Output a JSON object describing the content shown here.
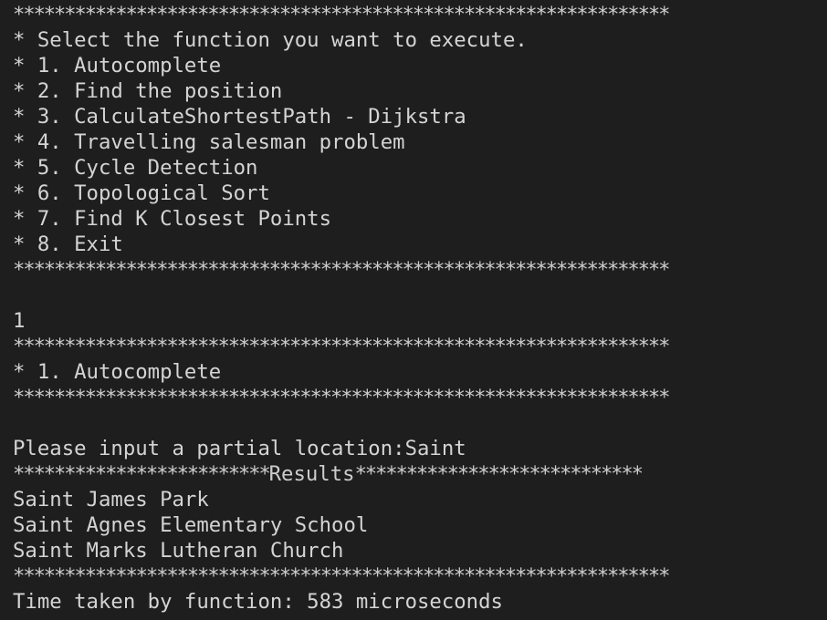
{
  "terminal": {
    "background": "#1e1e1e",
    "foreground": "#d4d4d4",
    "separator": "****************************************************************",
    "menu": {
      "prompt": "* Select the function you want to execute.",
      "items": [
        "* 1. Autocomplete",
        "* 2. Find the position",
        "* 3. CalculateShortestPath - Dijkstra",
        "* 4. Travelling salesman problem",
        "* 5. Cycle Detection",
        "* 6. Topological Sort",
        "* 7. Find K Closest Points",
        "* 8. Exit"
      ]
    },
    "user_choice": "1",
    "selected_function": "* 1. Autocomplete",
    "input_prompt": "Please input a partial location:",
    "input_value": "Saint",
    "results_header": {
      "left_stars": "*************************",
      "label": "Results",
      "right_stars": "****************************"
    },
    "results": [
      "Saint James Park",
      "Saint Agnes Elementary School",
      "Saint Marks Lutheran Church"
    ],
    "timing": "Time taken by function: 583 microseconds"
  }
}
